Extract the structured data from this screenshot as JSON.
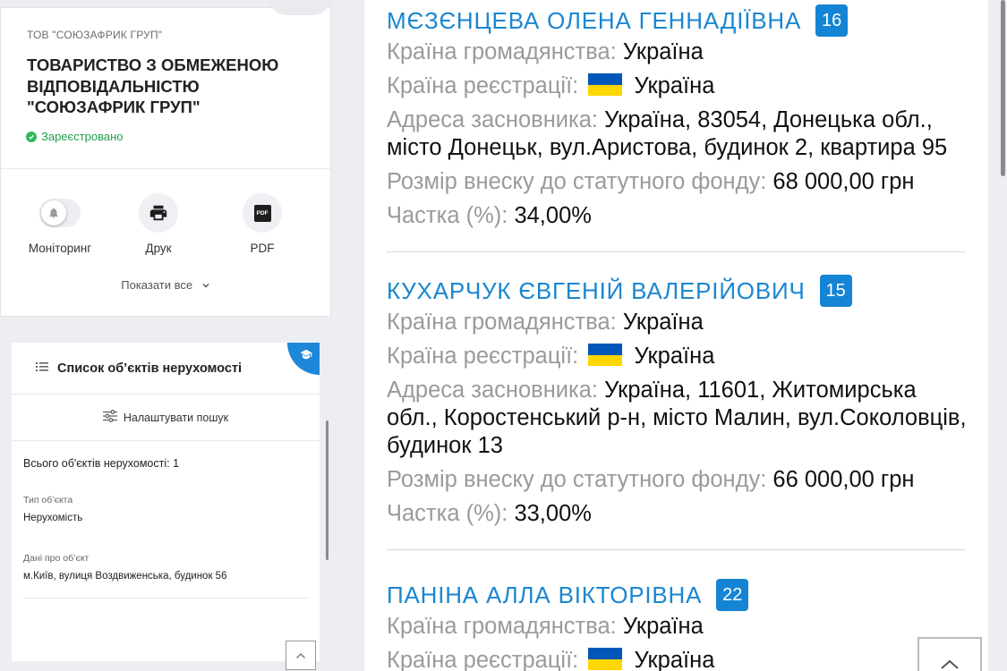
{
  "company": {
    "short_name": "ТОВ \"СОЮЗАФРИК ГРУП\"",
    "full_name": "ТОВАРИСТВО З ОБМЕЖЕНОЮ ВІДПОВІДАЛЬНІСТЮ \"СОЮЗАФРИК ГРУП\"",
    "status": "Зареєстровано",
    "status_color": "#21a04a"
  },
  "actions": {
    "monitoring": "Моніторинг",
    "print": "Друк",
    "pdf": "PDF",
    "pdf_icon_text": "PDF",
    "show_all": "Показати все"
  },
  "realty": {
    "title": "Список об’єктів нерухомості",
    "filter": "Налаштувати пошук",
    "total": "Всього об'єктів нерухомості: 1",
    "type_label": "Тип об’єкта",
    "type_value": "Нерухомість",
    "data_label": "Дані про об’єкт",
    "data_value": "м.Київ, вулиця Воздвиженська, будинок 56"
  },
  "labels": {
    "citizenship": "Країна громадянства:",
    "registration": "Країна реєстрації:",
    "address": "Адреса засновника:",
    "contribution": "Розмір внеску до статутного фонду:",
    "share": "Частка (%):"
  },
  "founders": [
    {
      "name": "МЄЗЄНЦЕВА ОЛЕНА ГЕННАДІЇВНА",
      "badge": "16",
      "citizenship": "Україна",
      "registration": "Україна",
      "address": "Україна, 83054, Донецька обл., місто Донецьк, вул.Аристова, будинок 2, квартира 95",
      "contribution": "68 000,00 грн",
      "share": "34,00%"
    },
    {
      "name": "КУХАРЧУК ЄВГЕНІЙ ВАЛЕРІЙОВИЧ",
      "badge": "15",
      "citizenship": "Україна",
      "registration": "Україна",
      "address": "Україна, 11601, Житомирська обл., Коростенський р-н, місто Малин, вул.Соколовців, будинок 13",
      "contribution": "66 000,00 грн",
      "share": "33,00%"
    },
    {
      "name": "ПАНІНА АЛЛА ВІКТОРІВНА",
      "badge": "22",
      "citizenship": "Україна",
      "registration": "Україна"
    }
  ],
  "colors": {
    "accent": "#1a86d0",
    "badge": "#1584d4",
    "flag_blue": "#0057b7",
    "flag_yellow": "#ffd700"
  },
  "icons": [
    "bell-icon",
    "print-icon",
    "pdf-icon",
    "chevron-down-icon",
    "list-icon",
    "sliders-icon",
    "graduation-cap-icon",
    "chevron-up-icon",
    "check-icon"
  ]
}
